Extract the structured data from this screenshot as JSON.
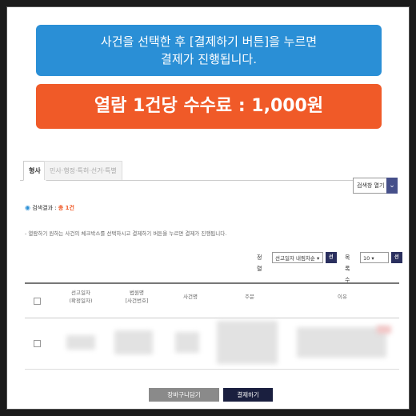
{
  "instruction": {
    "line1": "사건을 선택한 후 [결제하기 버튼]을 누르면",
    "line2": "결제가 진행됩니다."
  },
  "fee_banner": "열람 1건당 수수료 : 1,000원",
  "tabs": [
    {
      "label": "형사",
      "active": true
    },
    {
      "label": "민사·행정·특허·선거·특별",
      "active": false
    }
  ],
  "search_toggle": {
    "label": "검색창 열기"
  },
  "result": {
    "label": "검색결과 : ",
    "count": "총 1건"
  },
  "info": "- 열람하기 원하는 사건의 체크박스를 선택하시고 결제하기 버튼을 누르면 결제가 진행됩니다.",
  "sort": {
    "label": "정렬",
    "value": "선고일자 내림차순",
    "select_btn": "선택",
    "page_label": "목록수",
    "page_value": "10",
    "page_btn": "선택"
  },
  "table": {
    "headers": {
      "date": [
        "선고일자",
        "(확정일자)"
      ],
      "court": [
        "법원명",
        "[사건번호]"
      ],
      "case_name": "사건명",
      "order": "주문",
      "reason": "이유"
    }
  },
  "buttons": {
    "cart": "장바구니담기",
    "pay": "결제하기"
  },
  "colors": {
    "blue_banner": "#2a8fd6",
    "red_banner": "#f05a28",
    "dark_btn": "#1a1f3f"
  }
}
